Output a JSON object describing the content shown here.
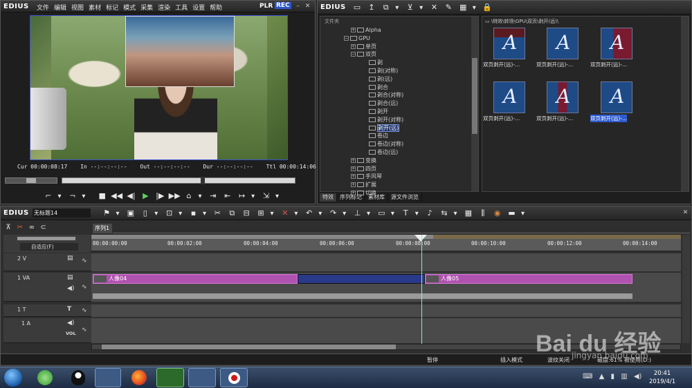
{
  "app": {
    "logo": "EDIUS"
  },
  "player": {
    "menu": [
      "文件",
      "编辑",
      "视图",
      "素材",
      "标记",
      "模式",
      "采集",
      "渲染",
      "工具",
      "设置",
      "帮助"
    ],
    "plr": "PLR",
    "rec": "REC",
    "timecodes": {
      "cur_label": "Cur",
      "cur": "00:00:08:17",
      "in_label": "In",
      "in": "--:--:--:--",
      "out_label": "Out",
      "out": "--:--:--:--",
      "dur_label": "Dur",
      "dur": "--:--:--:--",
      "ttl_label": "Ttl",
      "ttl": "00:00:14:06"
    }
  },
  "bin": {
    "logo": "EDIUS",
    "folder_header": "文件夹",
    "path": "\\特效\\转场\\GPU\\双页\\剥开(远)\\",
    "tree": [
      "Alpha",
      "GPU",
      "单页",
      "双页",
      "剥",
      "剥(对称)",
      "剥(远)",
      "剥合",
      "剥合(对称)",
      "剥合(远)",
      "剥开",
      "剥开(对称)",
      "剥开(远)",
      "卷边",
      "卷边(对称)",
      "卷边(远)",
      "变换",
      "四页",
      "手风琴",
      "扩展",
      "切换"
    ],
    "thumbs": [
      "双页剥开(远)-...",
      "双页剥开(远)-...",
      "双页剥开(远)-...",
      "双页剥开(远)-...",
      "双页剥开(远)-...",
      "双页剥开(远)-..."
    ],
    "tabs": [
      "特效",
      "序列标记",
      "素材库",
      "源文件浏览"
    ]
  },
  "timeline": {
    "logo": "EDIUS",
    "project": "无标题14",
    "sequence_tab": "序列1",
    "auto_label": "自适应(F)",
    "ruler": [
      "00:00:00:00",
      "00:00:02:00",
      "00:00:04:00",
      "00:00:06:00",
      "00:00:08:00",
      "00:00:10:00",
      "00:00:12:00",
      "00:00:14:00"
    ],
    "tracks": {
      "v2": "2 V",
      "va1": "1 VA",
      "t1": "1 T",
      "a1": "1 A",
      "vol": "VOL"
    },
    "clips": {
      "clip1": "人像04",
      "clip2": "人像05"
    }
  },
  "status": {
    "pause": "暂停",
    "insert": "插入模式",
    "ripple": "波纹关闭",
    "disk": "磁盘:61% 被使用(D:)"
  },
  "taskbar": {
    "time": "20:41",
    "date": "2019/4/1"
  },
  "watermark": {
    "text": "Bai du 经验",
    "url": "jingyan.baidu.com"
  }
}
